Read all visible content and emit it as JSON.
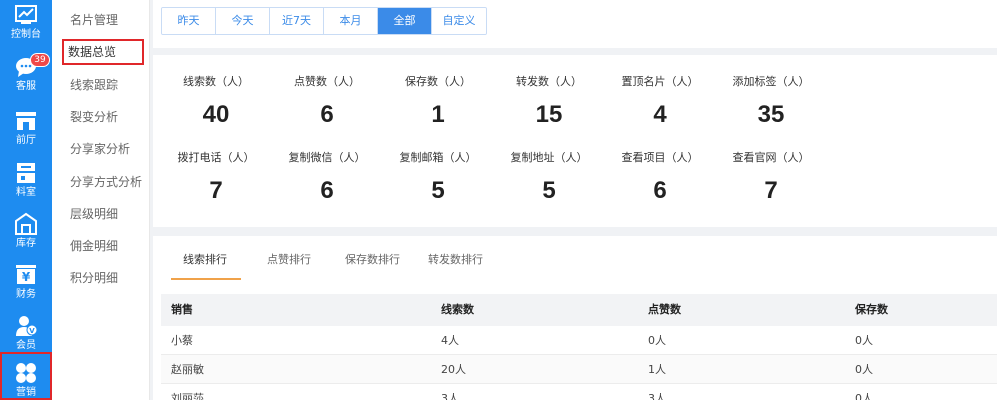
{
  "nav": [
    {
      "label": "控制台",
      "icon": "chart-icon"
    },
    {
      "label": "客服",
      "icon": "chat-icon",
      "badge": "39"
    },
    {
      "label": "前厅",
      "icon": "storefront-icon"
    },
    {
      "label": "料室",
      "icon": "kitchen-icon"
    },
    {
      "label": "库存",
      "icon": "warehouse-icon"
    },
    {
      "label": "财务",
      "icon": "yuan-icon"
    },
    {
      "label": "会员",
      "icon": "member-icon"
    },
    {
      "label": "营销",
      "icon": "grid-icon"
    }
  ],
  "submenu": [
    "名片管理",
    "数据总览",
    "线索跟踪",
    "裂变分析",
    "分享家分析",
    "分享方式分析",
    "层级明细",
    "佣金明细",
    "积分明细"
  ],
  "filters": [
    "昨天",
    "今天",
    "近7天",
    "本月",
    "全部",
    "自定义"
  ],
  "stats": [
    {
      "title": "线索数（人）",
      "value": "40"
    },
    {
      "title": "点赞数（人）",
      "value": "6"
    },
    {
      "title": "保存数（人）",
      "value": "1"
    },
    {
      "title": "转发数（人）",
      "value": "15"
    },
    {
      "title": "置顶名片（人）",
      "value": "4"
    },
    {
      "title": "添加标签（人）",
      "value": "35"
    },
    {
      "title": "拨打电话（人）",
      "value": "7"
    },
    {
      "title": "复制微信（人）",
      "value": "6"
    },
    {
      "title": "复制邮箱（人）",
      "value": "5"
    },
    {
      "title": "复制地址（人）",
      "value": "5"
    },
    {
      "title": "查看项目（人）",
      "value": "6"
    },
    {
      "title": "查看官网（人）",
      "value": "7"
    }
  ],
  "tabs": [
    "线索排行",
    "点赞排行",
    "保存数排行",
    "转发数排行"
  ],
  "table": {
    "headers": [
      "销售",
      "线索数",
      "点赞数",
      "保存数"
    ],
    "rows": [
      [
        "小蔡",
        "4人",
        "0人",
        "0人"
      ],
      [
        "赵丽敏",
        "20人",
        "1人",
        "0人"
      ],
      [
        "刘丽莎",
        "3人",
        "3人",
        "0人"
      ]
    ]
  }
}
